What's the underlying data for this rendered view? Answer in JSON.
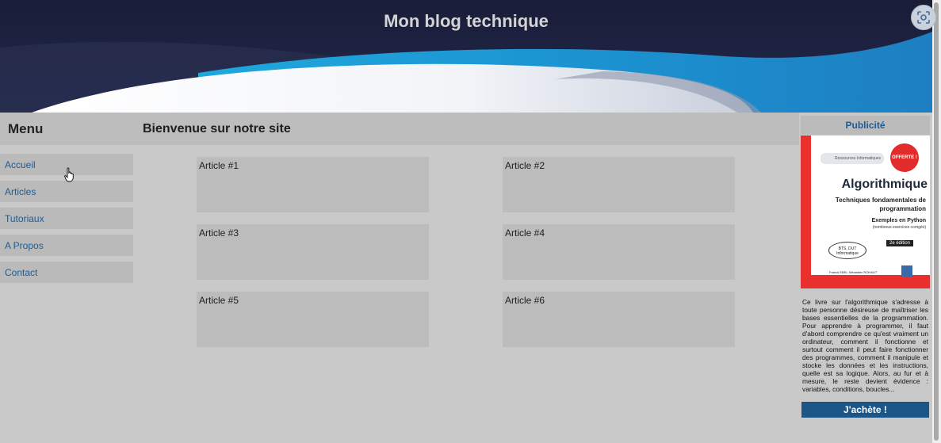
{
  "header": {
    "title": "Mon blog technique"
  },
  "sidebar": {
    "title": "Menu",
    "items": [
      {
        "label": "Accueil"
      },
      {
        "label": "Articles"
      },
      {
        "label": "Tutoriaux"
      },
      {
        "label": "A Propos"
      },
      {
        "label": "Contact"
      }
    ]
  },
  "main": {
    "title": "Bienvenue sur notre site",
    "articles": [
      {
        "label": "Article #1"
      },
      {
        "label": "Article #2"
      },
      {
        "label": "Article #3"
      },
      {
        "label": "Article #4"
      },
      {
        "label": "Article #5"
      },
      {
        "label": "Article #6"
      }
    ]
  },
  "ad": {
    "title": "Publicité",
    "book": {
      "collection": "Ressources Informatiques",
      "badge": "OFFERTE !",
      "title": "Algorithmique",
      "subtitle": "Techniques fondamentales de programmation",
      "examples": "Exemples en Python",
      "exercises": "(nombreux exercices corrigés)",
      "edition": "2e édition",
      "audience": "BTS, DUT Informatique",
      "authors": "Franck EBEL  Sébastien ROHAUT"
    },
    "text": "Ce livre sur l'algorithmique s'adresse à toute personne désireuse de maîtriser les bases essentielles de la programmation. Pour apprendre à programmer, il faut d'abord comprendre ce qu'est vraiment un ordinateur, comment il fonctionne et surtout comment il peut faire fonctionner des programmes, comment il manipule et stocke les données et les instructions, quelle est sa logique. Alors, au fur et à mesure, le reste devient évidence : variables, conditions, boucles...",
    "button": "J'achète !"
  },
  "colors": {
    "header_bg": "#1c2140",
    "link": "#1e5b93",
    "button_bg": "#1c5689",
    "panel_bg": "#c9c9c9",
    "book_red": "#e8302f"
  },
  "icons": {
    "screenshot": "screenshot-capture-icon",
    "cursor": "hand-pointer-icon"
  }
}
